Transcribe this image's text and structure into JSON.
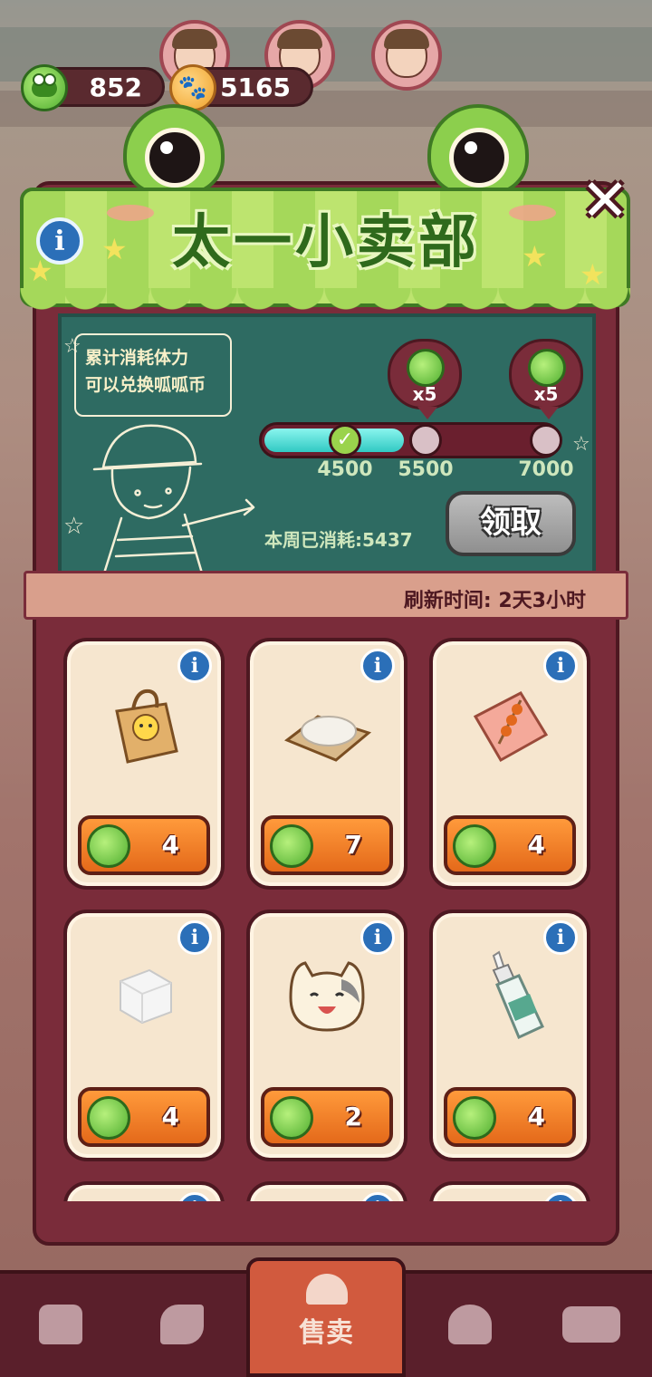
{
  "currency": {
    "frog_coins": "852",
    "paw_points": "5165"
  },
  "shop": {
    "title": "太一小卖部",
    "speech_line1": "累计消耗体力",
    "speech_line2": "可以兑换呱呱币",
    "weekly_consumed": "本周已消耗:5437",
    "claim_label": "领取",
    "refresh_text": "刷新时间:  2天3小时"
  },
  "progress": {
    "current": 5437,
    "min": 4000,
    "max": 7000,
    "milestones": [
      {
        "value": "4500",
        "state": "done"
      },
      {
        "value": "5500",
        "state": "locked",
        "reward": "x5"
      },
      {
        "value": "7000",
        "state": "locked",
        "reward": "x5"
      }
    ]
  },
  "items": [
    {
      "icon": "paper-bag-icon",
      "price": "4"
    },
    {
      "icon": "rice-on-board-icon",
      "price": "7"
    },
    {
      "icon": "skewer-snack-icon",
      "price": "4"
    },
    {
      "icon": "sugar-cube-icon",
      "price": "4"
    },
    {
      "icon": "cat-bun-icon",
      "price": "2"
    },
    {
      "icon": "glue-bottle-icon",
      "price": "4"
    },
    {
      "icon": "hidden-item-icon",
      "price": ""
    },
    {
      "icon": "hidden-item-icon",
      "price": ""
    },
    {
      "icon": "hidden-item-icon",
      "price": ""
    }
  ],
  "nav": {
    "active_label": "售卖",
    "items": [
      "bag-icon",
      "arrows-icon",
      "bell-icon",
      "map-pin-icon",
      "bus-icon"
    ]
  },
  "colors": {
    "awning_green": "#a5d85a",
    "board_green": "#2e6b62",
    "frame_maroon": "#7a2c3a",
    "price_orange": "#e4691a",
    "progress_cyan": "#31c9c3"
  }
}
